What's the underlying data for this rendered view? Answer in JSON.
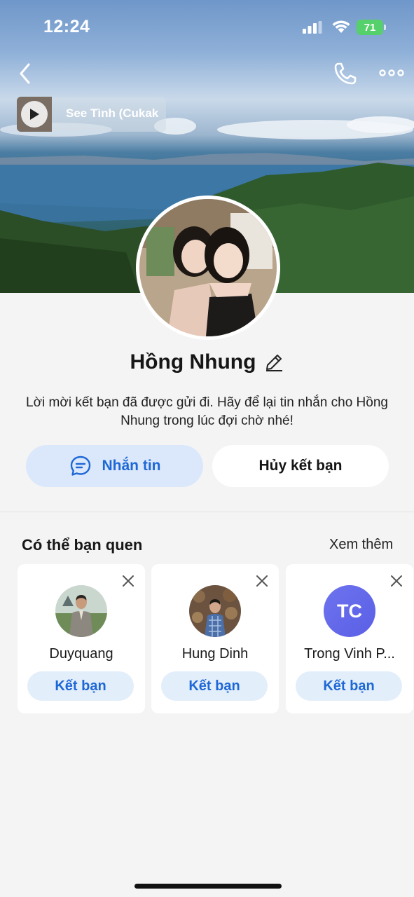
{
  "status_bar": {
    "time": "12:24",
    "battery": "71"
  },
  "music": {
    "title": "See Tình (Cukak"
  },
  "profile": {
    "name": "Hồng Nhung",
    "message": "Lời mời kết bạn đã được gửi đi. Hãy để lại tin nhắn cho Hồng Nhung trong lúc đợi chờ nhé!"
  },
  "actions": {
    "message_label": "Nhắn tin",
    "unfriend_label": "Hủy kết bạn"
  },
  "suggestions": {
    "title": "Có thể bạn quen",
    "see_more": "Xem thêm",
    "items": [
      {
        "name": "Duyquang",
        "button": "Kết bạn"
      },
      {
        "name": "Hung Dinh",
        "button": "Kết bạn"
      },
      {
        "name": "Trong Vinh P...",
        "initials": "TC",
        "button": "Kết bạn"
      }
    ]
  },
  "colors": {
    "accent": "#1e68d6",
    "accent_bg": "#dbe8fb",
    "page_bg": "#f4f4f5"
  }
}
